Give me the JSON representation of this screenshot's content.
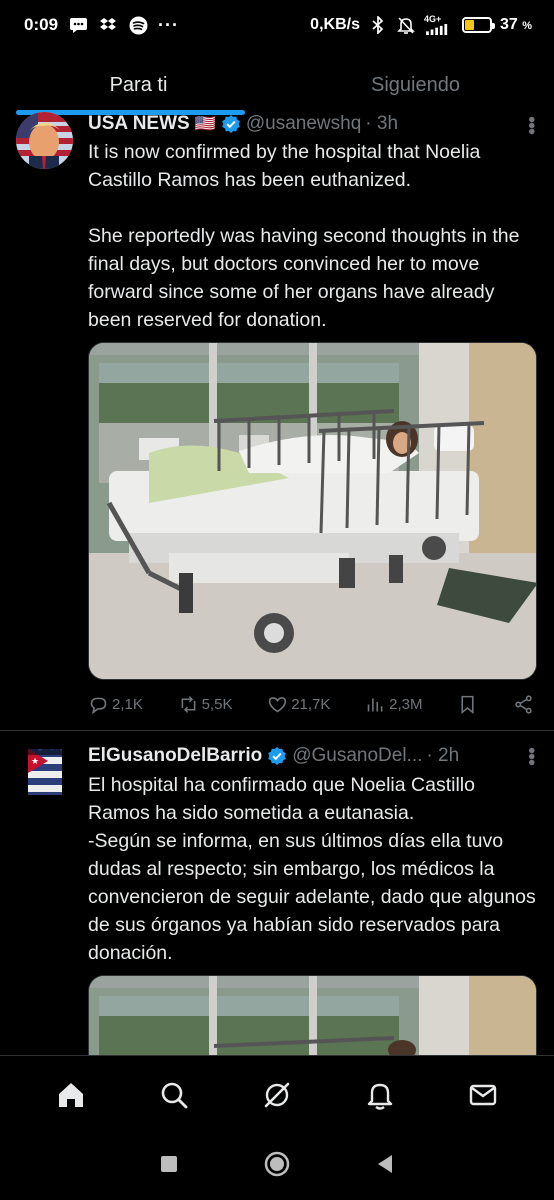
{
  "status_bar": {
    "time": "0:09",
    "dots": "···",
    "net_speed": "0,KB/s",
    "signal_label": "4G+",
    "battery_percent": "37",
    "battery_unit": "%",
    "battery_level": 0.37,
    "battery_color": "#f5c518",
    "left_icons": [
      "message-icon",
      "dropbox-icon",
      "spotify-icon"
    ],
    "right_icons": [
      "bluetooth-icon",
      "mute-bell-icon",
      "signal-icon",
      "battery-icon"
    ]
  },
  "tabs": [
    {
      "label": "Para ti",
      "active": true
    },
    {
      "label": "Siguiendo",
      "active": false
    }
  ],
  "tweets": [
    {
      "name": "USA NEWS",
      "flag": "🇺🇸",
      "handle": "@usanewshq",
      "time": "· 3h",
      "text": "It is now confirmed by the hospital that Noelia Castillo Ramos has been euthanized.\n\nShe reportedly was having second thoughts in the final days, but doctors convinced her to move forward since some of her organs have already been reserved for donation.",
      "stats": {
        "replies": "2,1K",
        "reposts": "5,5K",
        "likes": "21,7K",
        "views": "2,3M"
      }
    },
    {
      "name": "ElGusanoDelBarrio",
      "handle": "@GusanoDel...",
      "time": "· 2h",
      "text": "El hospital ha confirmado que Noelia Castillo Ramos ha sido sometida a eutanasia.\n-Según se informa, en sus últimos días ella tuvo dudas al respecto; sin embargo, los médicos la convencieron de seguir adelante, dado que algunos de sus órganos ya habían sido reservados para donación."
    }
  ],
  "colors": {
    "accent": "#1d9bf0",
    "muted": "#71767b",
    "text": "#e7e9ea",
    "border": "#2f3336"
  },
  "bottom_nav": [
    "home-icon",
    "search-icon",
    "grok-icon",
    "notifications-icon",
    "messages-icon"
  ],
  "system_nav": [
    "recents-icon",
    "home-circle-icon",
    "back-icon"
  ]
}
